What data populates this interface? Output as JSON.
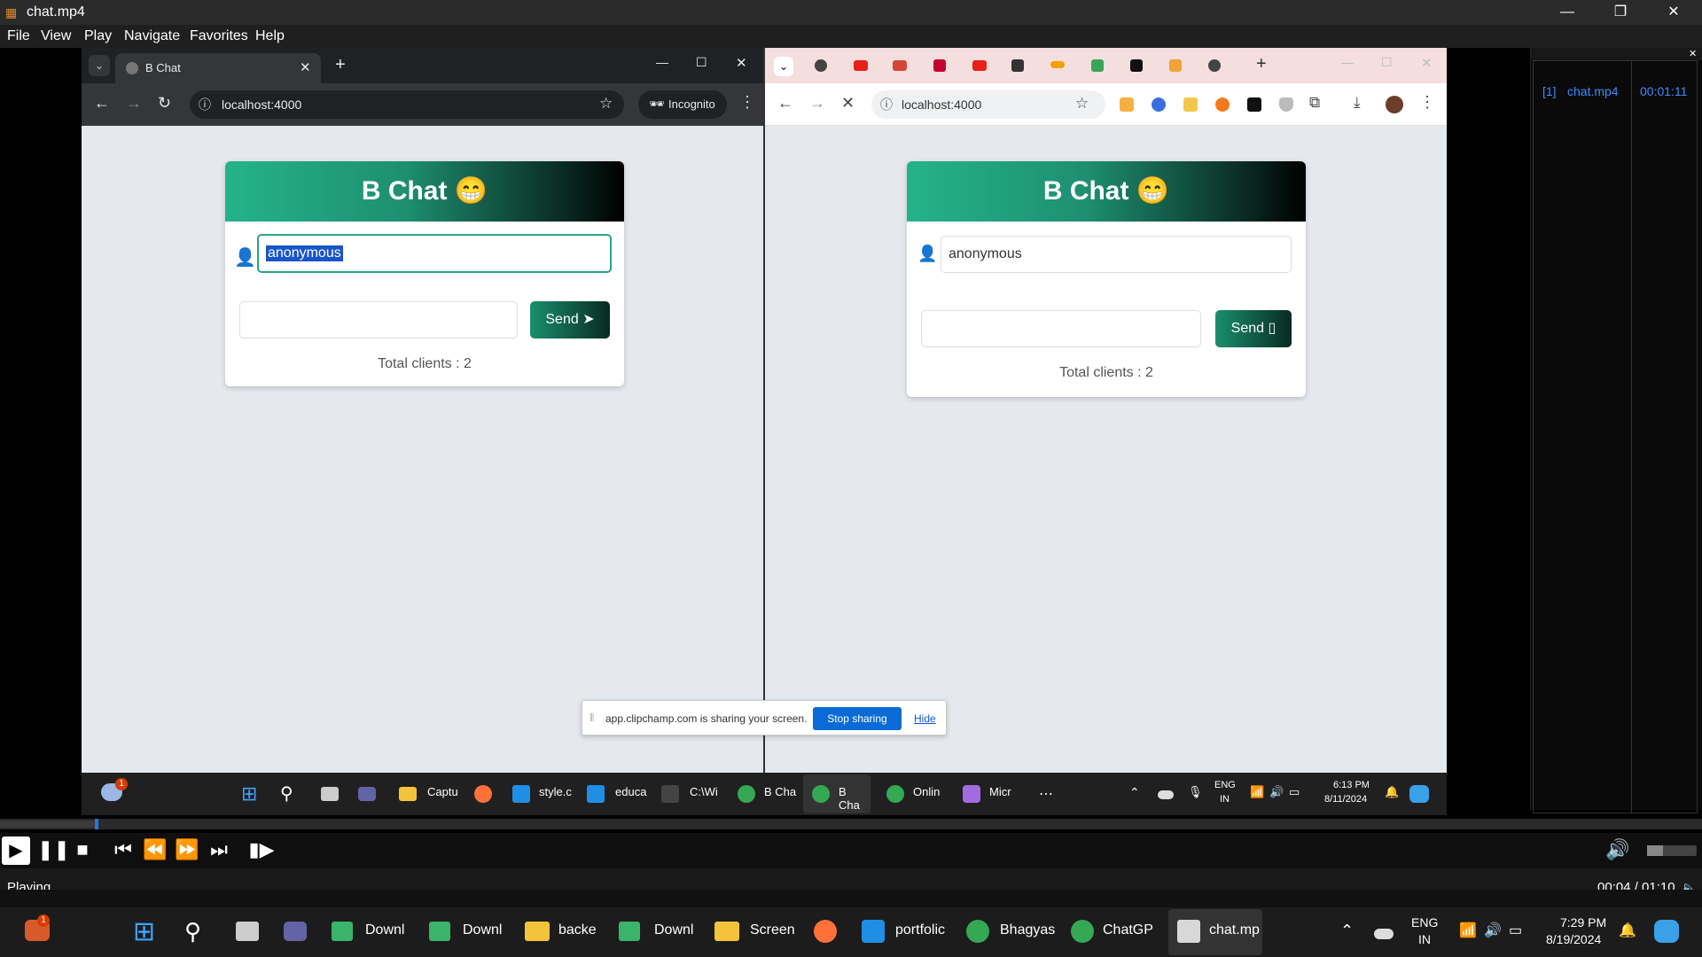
{
  "player": {
    "title": "chat.mp4",
    "menu": [
      "File",
      "View",
      "Play",
      "Navigate",
      "Favorites",
      "Help"
    ],
    "status": "Playing",
    "time": "00:04 / 01:10",
    "progress_fraction": 0.057,
    "playlist": {
      "index": "[1]",
      "name": "chat.mp4",
      "duration": "00:01:11"
    }
  },
  "left_browser": {
    "tab_title": "B Chat",
    "url": "localhost:4000",
    "incognito_label": "Incognito"
  },
  "right_browser": {
    "url": "localhost:4000"
  },
  "chat_left": {
    "header": "B Chat 😁",
    "name_value": "anonymous",
    "send_label": "Send",
    "clients": "Total clients : 2"
  },
  "chat_right": {
    "header": "B Chat 😁",
    "name_value": "anonymous",
    "send_label": "Send",
    "clients": "Total clients : 2"
  },
  "sharing_bar": {
    "text": "app.clipchamp.com is sharing your screen.",
    "stop_label": "Stop sharing",
    "hide_label": "Hide"
  },
  "inner_taskbar": {
    "items": [
      "Captu",
      "style.c",
      "educa",
      "C:\\Wi",
      "B Cha",
      "B Cha",
      "Onlin",
      "Micr"
    ],
    "lang": "ENG",
    "region": "IN",
    "time": "6:13 PM",
    "date": "8/11/2024",
    "weather_badge": "1"
  },
  "taskbar": {
    "items": [
      "Downl",
      "Downl",
      "backe",
      "Downl",
      "Screen",
      "portfolic",
      "Bhagyas",
      "ChatGP",
      "chat.mp"
    ],
    "lang": "ENG",
    "region": "IN",
    "time": "7:29 PM",
    "date": "8/19/2024",
    "badge": "1"
  }
}
